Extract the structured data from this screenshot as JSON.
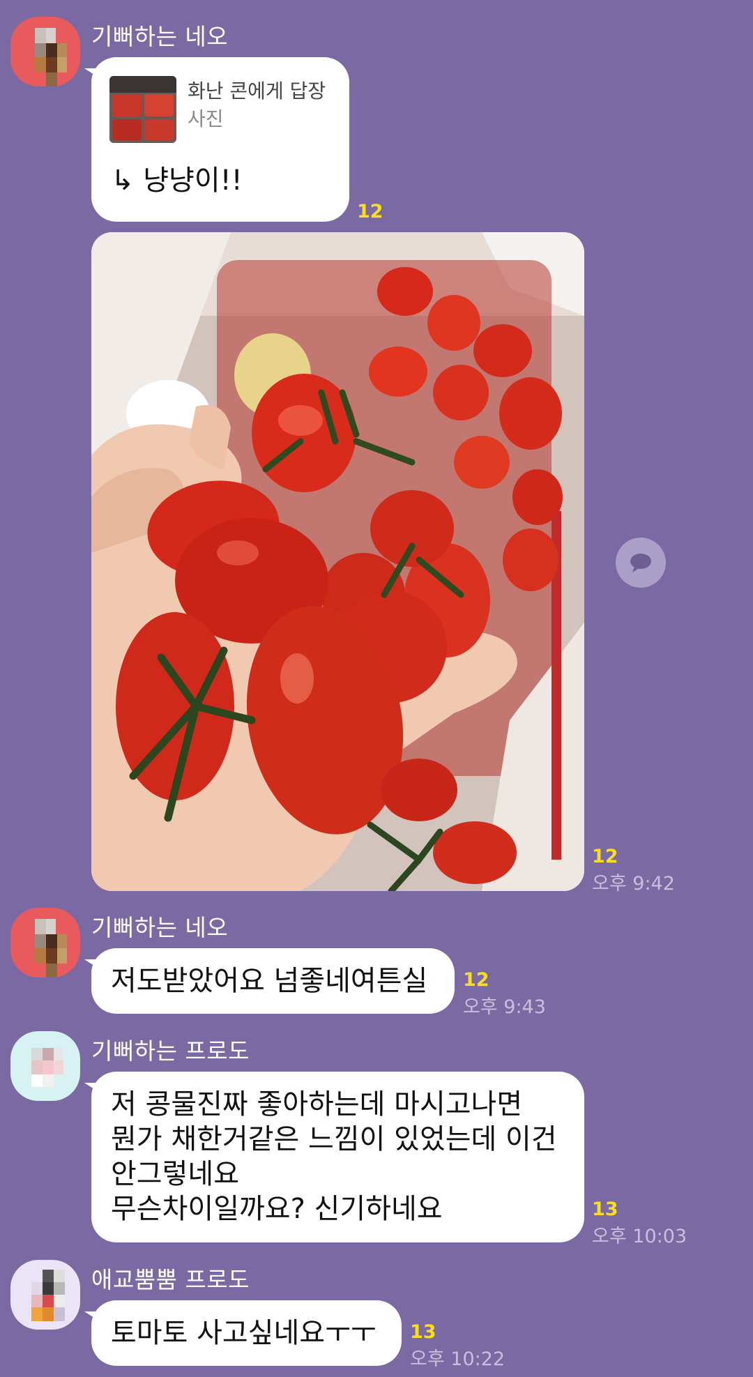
{
  "messages": [
    {
      "sender": "기뻐하는 네오",
      "reply": {
        "to": "화난 콘에게 답장",
        "type": "사진"
      },
      "text": "↳ 냥냥이!!",
      "unread": "12"
    },
    {
      "sender_ref": "기뻐하는 네오",
      "photo": "tomato-photo",
      "unread": "12",
      "time": "오후 9:42"
    },
    {
      "sender": "기뻐하는 네오",
      "text": "저도받았어요 넘좋네여튼실",
      "unread": "12",
      "time": "오후 9:43"
    },
    {
      "sender": "기뻐하는 프로도",
      "lines": [
        "저 콩물진짜 좋아하는데 마시고나면",
        "뭔가 채한거같은 느낌이 있었는데 이건",
        "안그렇네요",
        "무슨차이일까요? 신기하네요"
      ],
      "unread": "13",
      "time": "오후 10:03"
    },
    {
      "sender": "애교뿜뿜 프로도",
      "text": "토마토 사고싶네요ㅜㅜ",
      "unread": "13",
      "time": "오후 10:22"
    }
  ],
  "colors": {
    "background": "#7a69a3",
    "bubble": "#ffffff",
    "unread_count": "#f8de1e",
    "time": "#c7bfdc"
  },
  "icons": {
    "share": "speech-bubble-icon"
  }
}
